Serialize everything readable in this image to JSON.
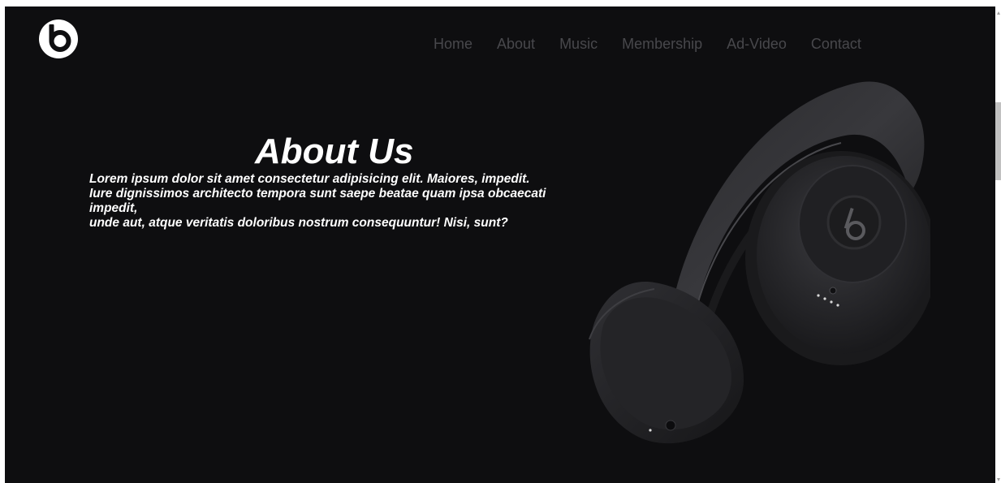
{
  "nav": {
    "items": [
      {
        "label": "Home"
      },
      {
        "label": "About"
      },
      {
        "label": "Music"
      },
      {
        "label": "Membership"
      },
      {
        "label": "Ad-Video"
      },
      {
        "label": "Contact"
      }
    ]
  },
  "about": {
    "title": "About Us",
    "lines": [
      "Lorem ipsum dolor sit amet consectetur adipisicing elit. Maiores, impedit.",
      "Iure dignissimos architecto tempora sunt saepe beatae quam ipsa obcaecati impedit,",
      "unde aut, atque veritatis doloribus nostrum consequuntur! Nisi, sunt?"
    ]
  },
  "colors": {
    "background": "#0e0e10",
    "nav_text": "#48484c",
    "text": "#ffffff"
  },
  "icons": {
    "logo": "beats-logo-icon",
    "product": "headphones-image"
  }
}
